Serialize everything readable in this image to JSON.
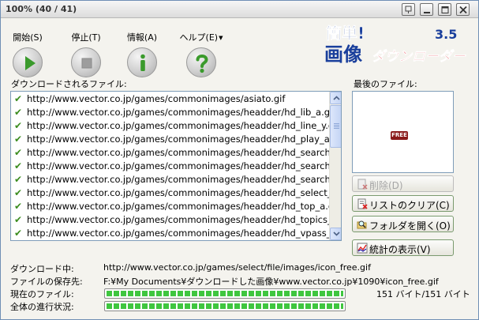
{
  "window": {
    "title": "100% (40 / 41)"
  },
  "toolbar": {
    "start_label": "開始(S)",
    "stop_label": "停止(T)",
    "info_label": "情報(A)",
    "help_label": "ヘルプ(E)"
  },
  "logo": {
    "line1": "簡単!",
    "line2": "画像",
    "brand": "ダウンローダー",
    "version": "3.5"
  },
  "file_list": {
    "label": "ダウンロードされるファイル:",
    "items": [
      "http://www.vector.co.jp/games/commonimages/asiato.gif",
      "http://www.vector.co.jp/games/commonimages/headder/hd_lib_a.gif",
      "http://www.vector.co.jp/games/commonimages/headder/hd_line_y.gif",
      "http://www.vector.co.jp/games/commonimages/headder/hd_play_a.gif",
      "http://www.vector.co.jp/games/commonimages/headder/hd_search_c.gif",
      "http://www.vector.co.jp/games/commonimages/headder/hd_search_l_sp.gif",
      "http://www.vector.co.jp/games/commonimages/headder/hd_search_r.gif",
      "http://www.vector.co.jp/games/commonimages/headder/hd_select_a.gif",
      "http://www.vector.co.jp/games/commonimages/headder/hd_top_a.gif",
      "http://www.vector.co.jp/games/commonimages/headder/hd_topics_c.gif",
      "http://www.vector.co.jp/games/commonimages/headder/hd_vpass_a.gif"
    ]
  },
  "preview": {
    "label": "最後のファイル:",
    "badge": "FREE"
  },
  "actions": {
    "delete_label": "削除(D)",
    "clear_label": "リストのクリア(C)",
    "open_folder_label": "フォルダを開く(O)",
    "stats_label": "統計の表示(V)"
  },
  "status": {
    "downloading_label": "ダウンロード中:",
    "downloading_value": "http://www.vector.co.jp/games/select/file/images/icon_free.gif",
    "save_label": "ファイルの保存先:",
    "save_value": "F:¥My Documents¥ダウンロードした画像¥www.vector.co.jp¥1090¥icon_free.gif",
    "current_label": "現在のファイル:",
    "current_bytes": "151 バイト/151 バイト",
    "current_progress": 1.0,
    "overall_label": "全体の進行状況:",
    "overall_progress": 1.0
  },
  "colors": {
    "check": "#3b8c1e",
    "progress": "#3fc63f",
    "logo_red": "#e0202a",
    "logo_blue": "#1a3f9c"
  }
}
